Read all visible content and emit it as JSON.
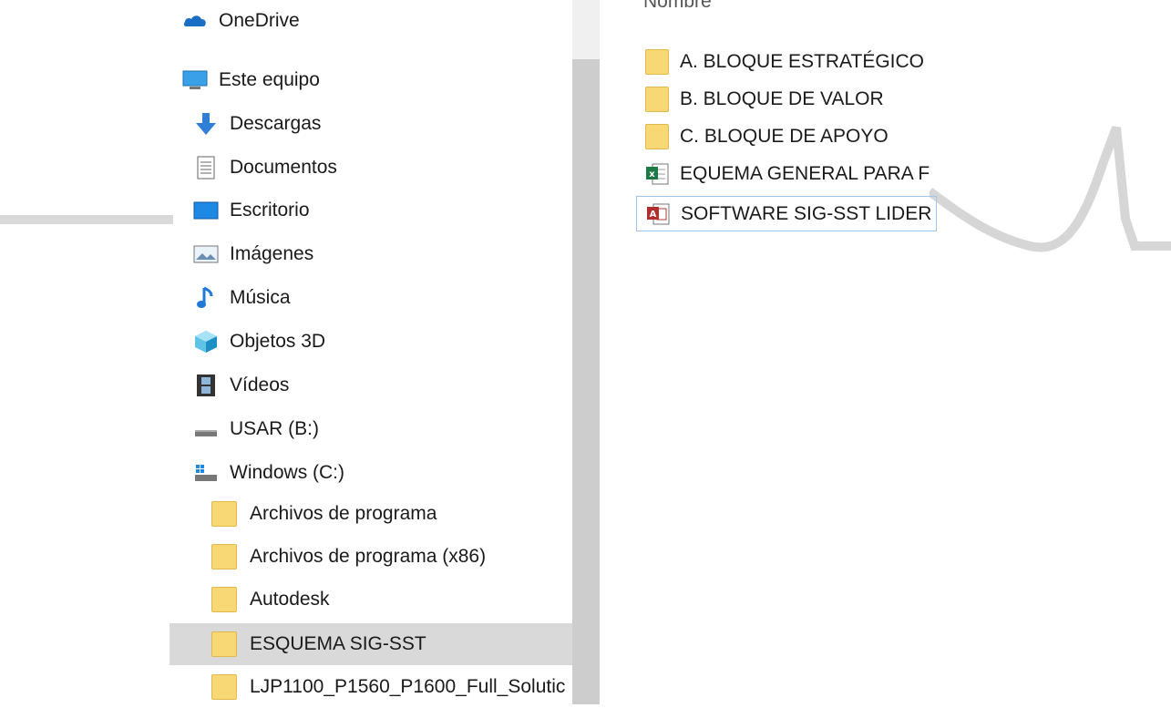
{
  "nav": {
    "items": [
      {
        "label": "OneDrive",
        "icon": "onedrive-icon"
      },
      {
        "label": "Este equipo",
        "icon": "computer-icon"
      },
      {
        "label": "Descargas",
        "icon": "download-arrow-icon"
      },
      {
        "label": "Documentos",
        "icon": "document-icon"
      },
      {
        "label": "Escritorio",
        "icon": "desktop-icon"
      },
      {
        "label": "Imágenes",
        "icon": "pictures-icon"
      },
      {
        "label": "Música",
        "icon": "music-note-icon"
      },
      {
        "label": "Objetos 3D",
        "icon": "cube-3d-icon"
      },
      {
        "label": "Vídeos",
        "icon": "film-icon"
      },
      {
        "label": "USAR (B:)",
        "icon": "drive-icon"
      },
      {
        "label": "Windows (C:)",
        "icon": "windows-drive-icon"
      },
      {
        "label": "Archivos de programa",
        "icon": "folder-icon"
      },
      {
        "label": "Archivos de programa (x86)",
        "icon": "folder-icon"
      },
      {
        "label": "Autodesk",
        "icon": "folder-icon"
      },
      {
        "label": "ESQUEMA SIG-SST",
        "icon": "folder-icon",
        "selected": true
      },
      {
        "label": "LJP1100_P1560_P1600_Full_Solutic",
        "icon": "folder-icon"
      }
    ]
  },
  "list": {
    "column_header": "Nombre",
    "files": [
      {
        "name": "A. BLOQUE ESTRATÉGICO",
        "icon": "folder-icon"
      },
      {
        "name": "B. BLOQUE DE VALOR",
        "icon": "folder-icon"
      },
      {
        "name": "C. BLOQUE DE APOYO",
        "icon": "folder-icon"
      },
      {
        "name": "EQUEMA GENERAL PARA F",
        "icon": "excel-file-icon"
      },
      {
        "name": "SOFTWARE SIG-SST LIDER",
        "icon": "access-file-icon",
        "focused": true
      }
    ]
  },
  "colors": {
    "selection": "#d9d9d9",
    "focus_border": "#9fc6ea",
    "folder": "#f8d775"
  }
}
